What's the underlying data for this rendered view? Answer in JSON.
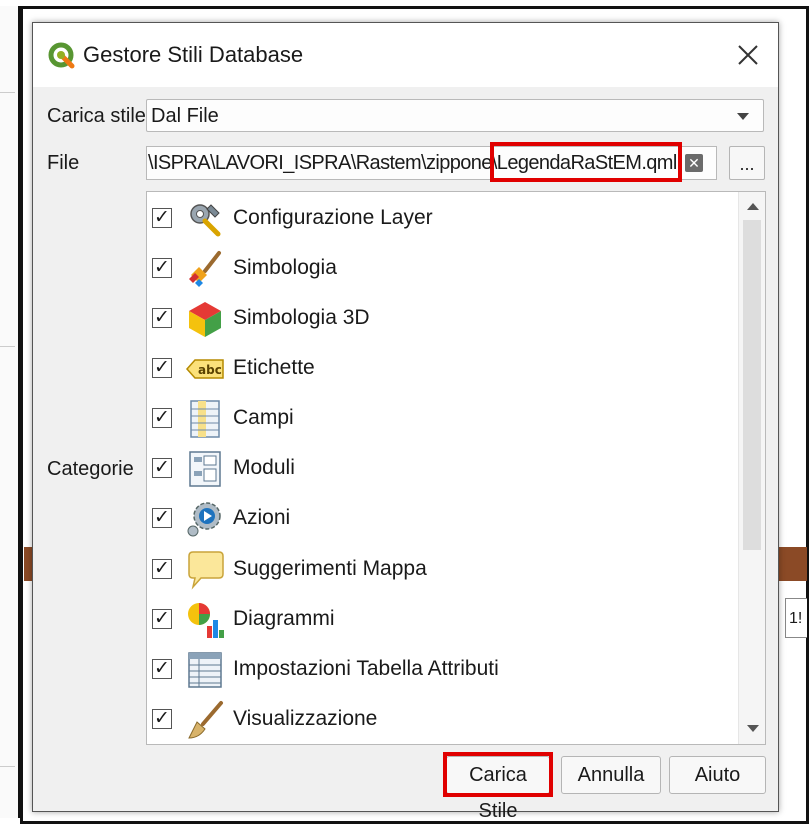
{
  "dialog": {
    "title": "Gestore Stili Database",
    "close_icon": "close-icon"
  },
  "load_style": {
    "label": "Carica stile",
    "value": "Dal File"
  },
  "file": {
    "label": "File",
    "path_prefix": "\\ISPRA\\LAVORI_ISPRA\\Rastem\\zippone\\",
    "path_highlight": "LegendaRaStEM.qml",
    "browse_label": "...",
    "clear_glyph": "✕"
  },
  "categories": {
    "label": "Categorie",
    "items": [
      {
        "label": "Configurazione Layer",
        "checked": true,
        "icon": "layer-config-icon"
      },
      {
        "label": "Simbologia",
        "checked": true,
        "icon": "symbology-brush-icon"
      },
      {
        "label": "Simbologia 3D",
        "checked": true,
        "icon": "cube-3d-icon"
      },
      {
        "label": "Etichette",
        "checked": true,
        "icon": "abc-label-icon"
      },
      {
        "label": "Campi",
        "checked": true,
        "icon": "fields-icon"
      },
      {
        "label": "Moduli",
        "checked": true,
        "icon": "forms-icon"
      },
      {
        "label": "Azioni",
        "checked": true,
        "icon": "actions-gear-icon"
      },
      {
        "label": "Suggerimenti Mappa",
        "checked": true,
        "icon": "map-tips-bubble-icon"
      },
      {
        "label": "Diagrammi",
        "checked": true,
        "icon": "diagram-pie-icon"
      },
      {
        "label": "Impostazioni Tabella Attributi",
        "checked": true,
        "icon": "attribute-table-icon"
      },
      {
        "label": "Visualizzazione",
        "checked": true,
        "icon": "rendering-brush-icon"
      }
    ]
  },
  "buttons": {
    "load": "Carica Stile",
    "cancel": "Annulla",
    "help": "Aiuto"
  },
  "background": {
    "right_box_text": "1!"
  },
  "colors": {
    "highlight": "#e00000",
    "qgis_green": "#589632",
    "qgis_yellow": "#ee7913"
  }
}
